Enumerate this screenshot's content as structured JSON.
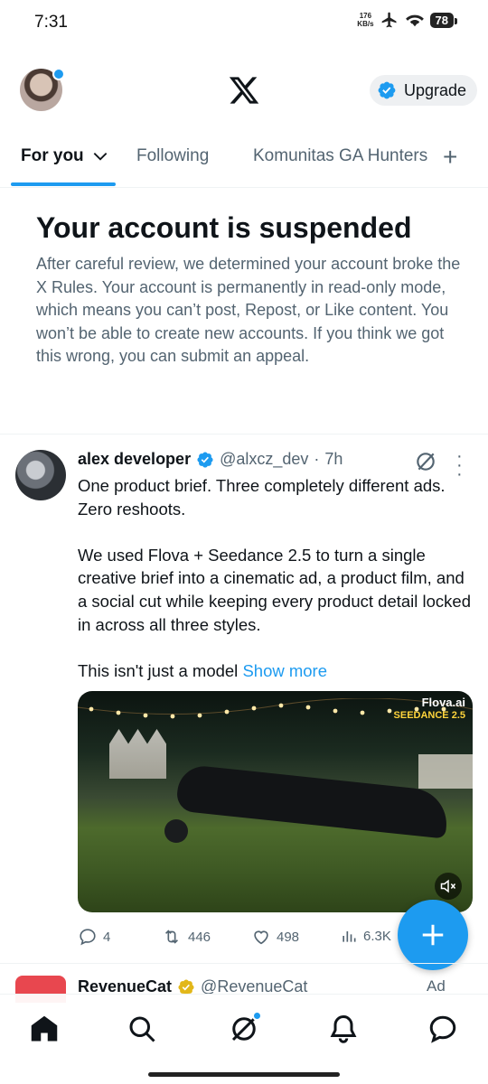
{
  "status_bar": {
    "time": "7:31",
    "net_speed_value": "176",
    "net_speed_unit": "KB/s",
    "battery": "78"
  },
  "header": {
    "upgrade_label": "Upgrade"
  },
  "tabs": [
    {
      "label": "For you",
      "active": true
    },
    {
      "label": "Following",
      "active": false
    },
    {
      "label": "Komunitas GA Hunters",
      "active": false
    }
  ],
  "suspension": {
    "title": "Your account is suspended",
    "body": "After careful review, we determined your account broke the X Rules. Your account is permanently in read-only mode, which means you can’t post, Repost, or Like content. You won’t be able to create new accounts. If you think we got this wrong, you can submit an appeal."
  },
  "tweet": {
    "name": "alex developer",
    "handle": "@alxcz_dev",
    "separator": "·",
    "time": "7h",
    "paragraphs": [
      "One product brief. Three completely different ads. Zero reshoots.",
      "We used Flova + Seedance 2.5 to turn a single creative brief into a cinematic ad, a product film, and a social cut while keeping every product detail locked in across all three styles."
    ],
    "last_line": "This isn't just a model",
    "show_more": "Show more",
    "media_brand_1": "Flova.ai",
    "media_brand_2": "SEEDANCE 2.5",
    "replies": "4",
    "reposts": "446",
    "likes": "498",
    "views": "6.3K"
  },
  "ad_tweet": {
    "name": "RevenueCat",
    "handle": "@RevenueCat",
    "ad_label": "Ad"
  },
  "colors": {
    "accent": "#1d9bf0",
    "text_primary": "#0f1419",
    "text_secondary": "#536471",
    "verified_gold": "#e2b719"
  }
}
